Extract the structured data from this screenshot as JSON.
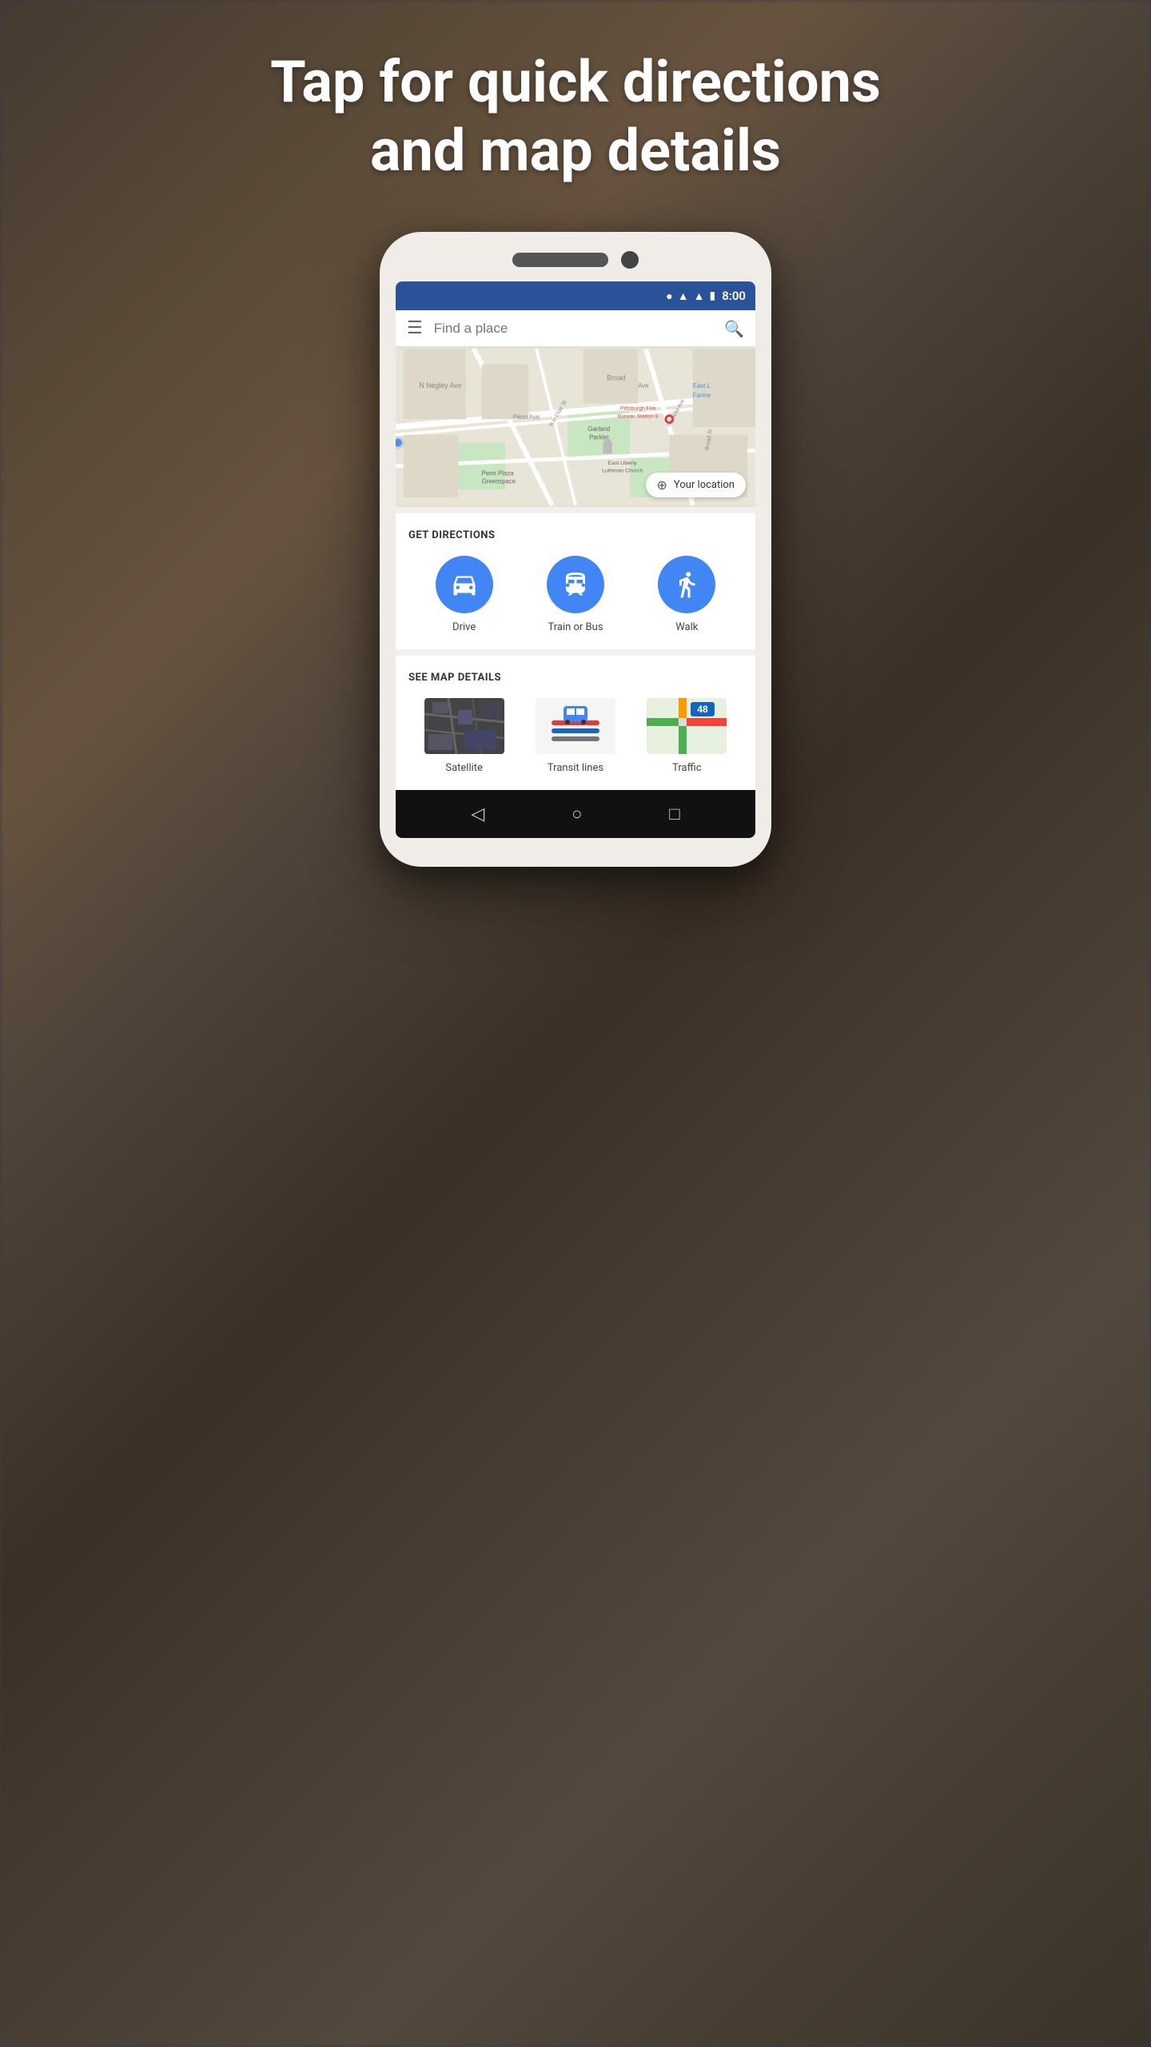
{
  "page": {
    "title_line1": "Tap for quick directions",
    "title_line2": "and map details"
  },
  "status_bar": {
    "time": "8:00",
    "bg_color": "#2a5298"
  },
  "search": {
    "placeholder": "Find a place"
  },
  "map": {
    "your_location_label": "Your location"
  },
  "get_directions": {
    "section_title": "GET DIRECTIONS",
    "items": [
      {
        "label": "Drive",
        "icon": "car"
      },
      {
        "label": "Train or Bus",
        "icon": "transit"
      },
      {
        "label": "Walk",
        "icon": "walk"
      }
    ]
  },
  "see_map_details": {
    "section_title": "SEE MAP DETAILS",
    "items": [
      {
        "label": "Satellite",
        "type": "satellite"
      },
      {
        "label": "Transit lines",
        "type": "transit"
      },
      {
        "label": "Traffic",
        "type": "traffic"
      }
    ]
  },
  "nav": {
    "back": "◁",
    "home": "○",
    "recents": "□"
  }
}
